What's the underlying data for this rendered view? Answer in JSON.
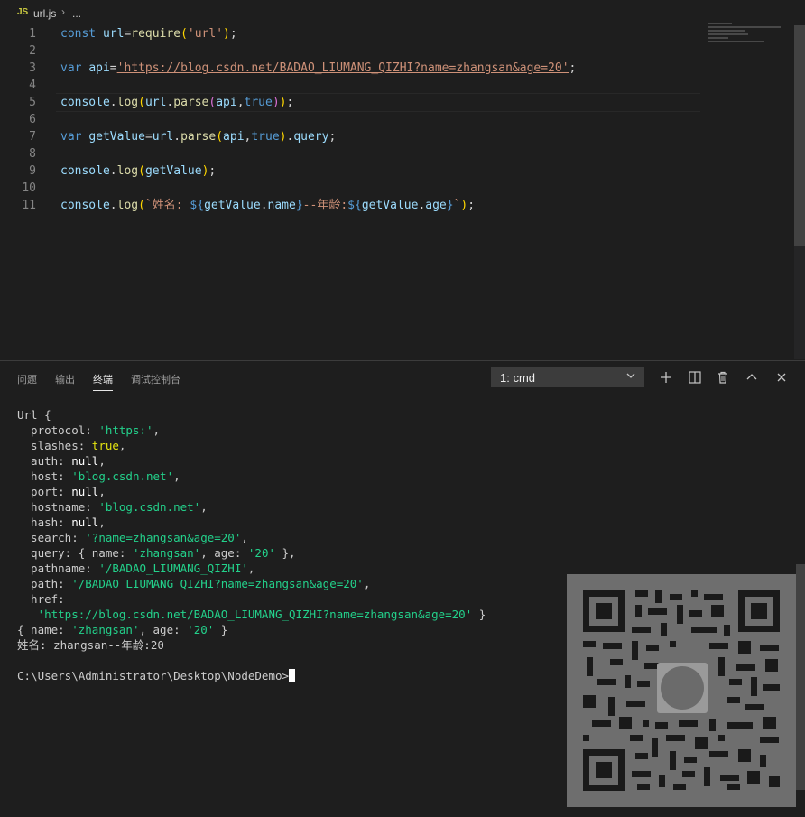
{
  "breadcrumb": {
    "icon": "JS",
    "file": "url.js",
    "separator": "›",
    "more": "..."
  },
  "editor": {
    "line_numbers": [
      "1",
      "2",
      "3",
      "4",
      "5",
      "6",
      "7",
      "8",
      "9",
      "10",
      "11"
    ]
  },
  "panel": {
    "tabs": [
      "问题",
      "输出",
      "终端",
      "调试控制台"
    ],
    "active_tab": "终端",
    "terminal_select": "1: cmd"
  },
  "terminal": {
    "prompt": "C:\\Users\\Administrator\\Desktop\\NodeDemo>",
    "output": {
      "l1": "Url {",
      "protocol_key": "  protocol: ",
      "protocol_val": "'https:'",
      "slashes_key": "  slashes: ",
      "slashes_val": "true",
      "auth_key": "  auth: ",
      "auth_val": "null",
      "host_key": "  host: ",
      "host_val": "'blog.csdn.net'",
      "port_key": "  port: ",
      "port_val": "null",
      "hostname_key": "  hostname: ",
      "hostname_val": "'blog.csdn.net'",
      "hash_key": "  hash: ",
      "hash_val": "null",
      "search_key": "  search: ",
      "search_val": "'?name=zhangsan&age=20'",
      "query_key": "  query: { name: ",
      "query_name": "'zhangsan'",
      "query_mid": ", age: ",
      "query_age": "'20'",
      "query_end": " },",
      "pathname_key": "  pathname: ",
      "pathname_val": "'/BADAO_LIUMANG_QIZHI'",
      "path_key": "  path: ",
      "path_val": "'/BADAO_LIUMANG_QIZHI?name=zhangsan&age=20'",
      "href_key": "  href:",
      "href_val": "'https://blog.csdn.net/BADAO_LIUMANG_QIZHI?name=zhangsan&age=20'",
      "href_end": " }",
      "obj_start": "{ name: ",
      "obj_name": "'zhangsan'",
      "obj_mid": ", age: ",
      "obj_age": "'20'",
      "obj_end": " }",
      "summary": "姓名: zhangsan--年龄:20"
    }
  },
  "icons": {
    "add": "+",
    "split": "◫",
    "trash": "🗑",
    "up": "^",
    "close": "×",
    "dropdown": "∨"
  }
}
